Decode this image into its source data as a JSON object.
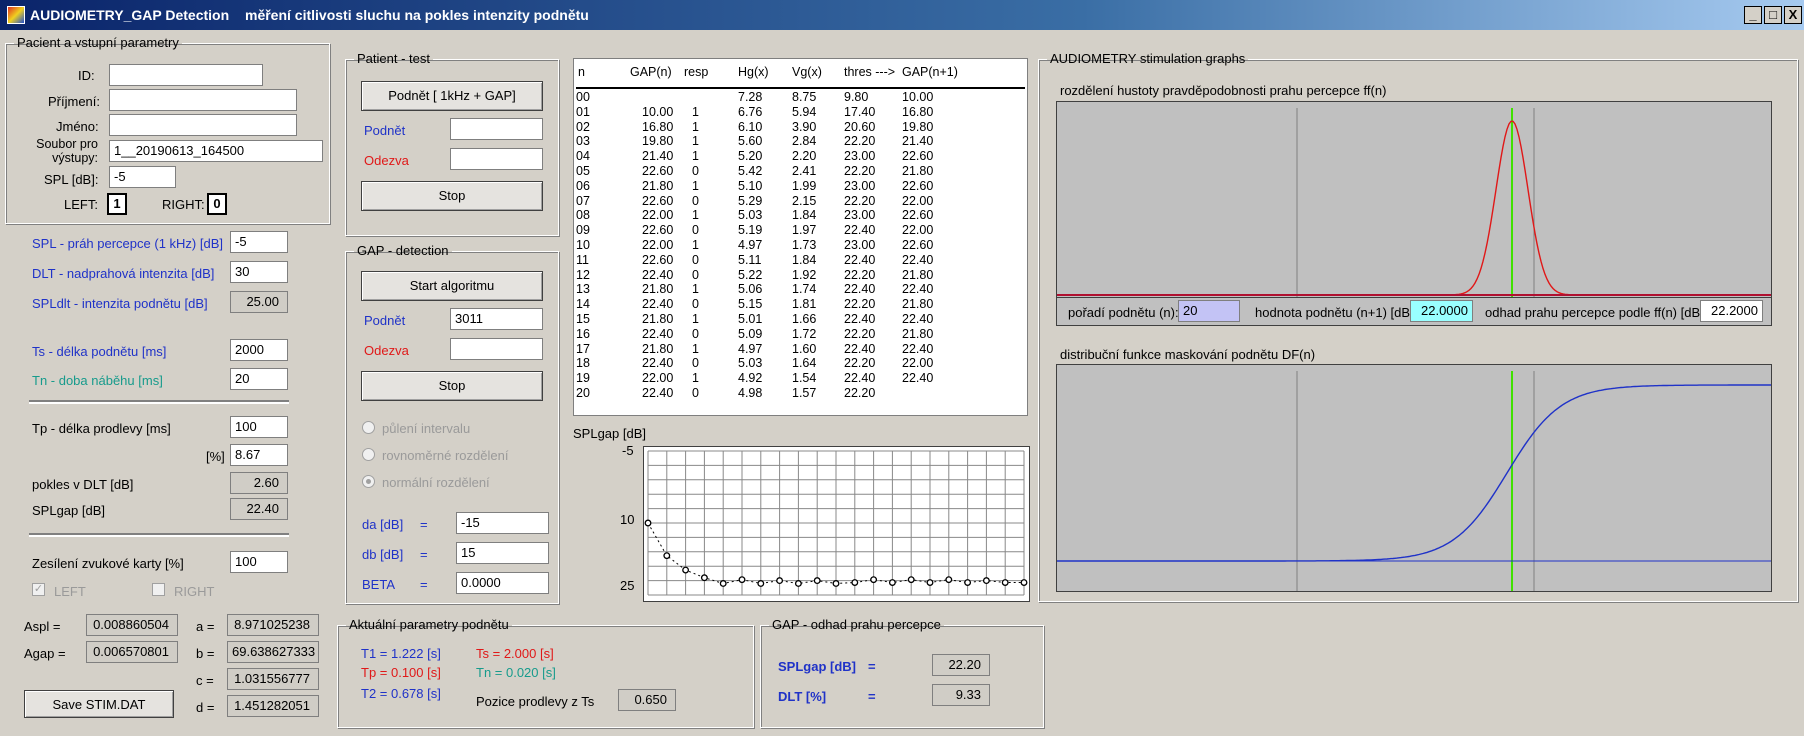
{
  "window": {
    "title": "AUDIOMETRY_GAP Detection",
    "subtitle": "měření citlivosti sluchu na pokles intenzity podnětu",
    "min": "_",
    "max": "□",
    "close": "X"
  },
  "patient": {
    "legend": "Pacient a vstupní parametry",
    "id_label": "ID:",
    "id": "",
    "surname_label": "Příjmení:",
    "surname": "",
    "name_label": "Jméno:",
    "name": "",
    "file_label": "Soubor pro výstupy:",
    "file": "1__20190613_164500",
    "spl_label": "SPL [dB]:",
    "spl": "-5",
    "left_label": "LEFT:",
    "left": "1",
    "right_label": "RIGHT:",
    "right": "0"
  },
  "params": {
    "spl_thr_label": "SPL - práh percepce (1 kHz) [dB]",
    "spl_thr": "-5",
    "dlt_label": "DLT - nadprahová intenzita [dB]",
    "dlt": "30",
    "spldlt_label": "SPLdlt - intenzita podnětu [dB]",
    "spldlt": "25.00",
    "ts_label": "Ts - délka podnětu [ms]",
    "ts": "2000",
    "tn_label": "Tn - doba náběhu [ms]",
    "tn": "20",
    "tp_label": "Tp - délka prodlevy [ms]",
    "tp": "100",
    "pct_label": "[%]",
    "pct": "8.67",
    "pokles_label": "pokles v DLT [dB]",
    "pokles": "2.60",
    "splgap_label": "SPLgap [dB]",
    "splgap": "22.40",
    "gain_label": "Zesílení zvukové karty [%]",
    "gain": "100",
    "left_chk": "LEFT",
    "right_chk": "RIGHT",
    "aspl_label": "Aspl =",
    "aspl": "0.008860504",
    "agap_label": "Agap =",
    "agap": "0.006570801",
    "a_label": "a =",
    "a": "8.971025238",
    "b_label": "b =",
    "b": "69.638627333",
    "c_label": "c =",
    "c": "1.031556777",
    "d_label": "d =",
    "d": "1.451282051",
    "save_btn": "Save STIM.DAT"
  },
  "test": {
    "legend": "Patient - test",
    "stim_btn": "Podnět  [ 1kHz + GAP]",
    "stim_label": "Podnět",
    "stim": "",
    "resp_label": "Odezva",
    "resp": "",
    "stop": "Stop"
  },
  "gap": {
    "legend": "GAP - detection",
    "start_btn": "Start algoritmu",
    "stim_label": "Podnět",
    "stim": "3011",
    "resp_label": "Odezva",
    "resp": "",
    "stop": "Stop",
    "opt1": "půlení intervalu",
    "opt2": "rovnoměrné rozdělení",
    "opt3": "normální rozdělení",
    "da_label": "da [dB]",
    "da": "-15",
    "db_label": "db [dB]",
    "db": "15",
    "beta_label": "BETA",
    "beta": "0.0000",
    "eq": "="
  },
  "table": {
    "headers": [
      "n",
      "GAP(n)",
      "resp",
      "Hg(x)",
      "Vg(x)",
      "thres --->",
      "GAP(n+1)"
    ],
    "rows": [
      [
        "00",
        "",
        "",
        "7.28",
        "8.75",
        "9.80",
        "10.00"
      ],
      [
        "01",
        "10.00",
        "1",
        "6.76",
        "5.94",
        "17.40",
        "16.80"
      ],
      [
        "02",
        "16.80",
        "1",
        "6.10",
        "3.90",
        "20.60",
        "19.80"
      ],
      [
        "03",
        "19.80",
        "1",
        "5.60",
        "2.84",
        "22.20",
        "21.40"
      ],
      [
        "04",
        "21.40",
        "1",
        "5.20",
        "2.20",
        "23.00",
        "22.60"
      ],
      [
        "05",
        "22.60",
        "0",
        "5.42",
        "2.41",
        "22.20",
        "21.80"
      ],
      [
        "06",
        "21.80",
        "1",
        "5.10",
        "1.99",
        "23.00",
        "22.60"
      ],
      [
        "07",
        "22.60",
        "0",
        "5.29",
        "2.15",
        "22.20",
        "22.00"
      ],
      [
        "08",
        "22.00",
        "1",
        "5.03",
        "1.84",
        "23.00",
        "22.60"
      ],
      [
        "09",
        "22.60",
        "0",
        "5.19",
        "1.97",
        "22.40",
        "22.00"
      ],
      [
        "10",
        "22.00",
        "1",
        "4.97",
        "1.73",
        "23.00",
        "22.60"
      ],
      [
        "11",
        "22.60",
        "0",
        "5.11",
        "1.84",
        "22.40",
        "22.40"
      ],
      [
        "12",
        "22.40",
        "0",
        "5.22",
        "1.92",
        "22.20",
        "21.80"
      ],
      [
        "13",
        "21.80",
        "1",
        "5.06",
        "1.74",
        "22.40",
        "22.40"
      ],
      [
        "14",
        "22.40",
        "0",
        "5.15",
        "1.81",
        "22.20",
        "21.80"
      ],
      [
        "15",
        "21.80",
        "1",
        "5.01",
        "1.66",
        "22.40",
        "22.40"
      ],
      [
        "16",
        "22.40",
        "0",
        "5.09",
        "1.72",
        "22.20",
        "21.80"
      ],
      [
        "17",
        "21.80",
        "1",
        "4.97",
        "1.60",
        "22.40",
        "22.40"
      ],
      [
        "18",
        "22.40",
        "0",
        "5.03",
        "1.64",
        "22.20",
        "22.00"
      ],
      [
        "19",
        "22.00",
        "1",
        "4.92",
        "1.54",
        "22.40",
        "22.40"
      ],
      [
        "20",
        "22.40",
        "0",
        "4.98",
        "1.57",
        "22.20",
        ""
      ]
    ]
  },
  "splgap_plot": {
    "title": "SPLgap [dB]",
    "y_ticks": [
      "-5",
      "10",
      "25"
    ]
  },
  "graphs": {
    "legend": "AUDIOMETRY stimulation graphs",
    "title1": "rozdělení hustoty pravděpodobnosti prahu percepce ff(n)",
    "order_label": "pořadí podnětu (n):",
    "order": "20",
    "value_label": "hodnota podnětu (n+1) [dB]:",
    "value": "22.0000",
    "est_label": "odhad prahu percepce podle ff(n) [dB]:",
    "est": "22.2000",
    "title2": "distribuční funkce maskování podnětu DF(n)"
  },
  "current": {
    "legend": "Aktuální parametry podnětu",
    "t1": "T1 =  1.222 [s]",
    "tp": "Tp =  0.100 [s]",
    "t2": "T2 =  0.678 [s]",
    "ts": "Ts =  2.000 [s]",
    "tn": "Tn =  0.020 [s]",
    "pos_label": "Pozice prodlevy z Ts",
    "pos": "0.650"
  },
  "estimate": {
    "legend": "GAP - odhad prahu percepce",
    "splgap_label": "SPLgap [dB]",
    "splgap": "22.20",
    "dlt_label": "DLT [%]",
    "dlt": "9.33",
    "eq": "="
  },
  "chart_data": {
    "type": "scatter",
    "title": "SPLgap [dB]",
    "y_axis_inverted": true,
    "ylim": [
      -5,
      25
    ],
    "x": [
      0,
      1,
      2,
      3,
      4,
      5,
      6,
      7,
      8,
      9,
      10,
      11,
      12,
      13,
      14,
      15,
      16,
      17,
      18,
      19,
      20
    ],
    "y": [
      10.0,
      16.8,
      19.8,
      21.4,
      22.6,
      21.8,
      22.6,
      22.0,
      22.6,
      22.0,
      22.6,
      22.4,
      21.8,
      22.4,
      21.8,
      22.4,
      21.8,
      22.4,
      22.0,
      22.4,
      22.4
    ]
  },
  "colors": {
    "title_bar": "#0a246a",
    "density_curve": "#e01818",
    "cdf_curve": "#1f32c8",
    "marker_line": "#40e000"
  }
}
